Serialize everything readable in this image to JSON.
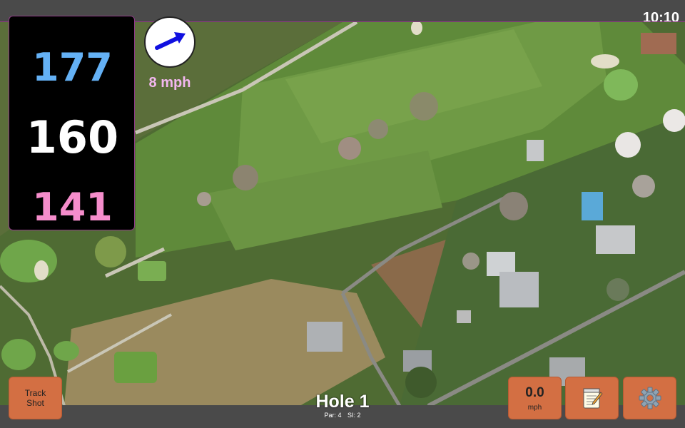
{
  "status": {
    "clock": "10:10"
  },
  "distances": {
    "back": "177",
    "middle": "160",
    "front": "141"
  },
  "wind": {
    "speed": "8 mph",
    "icon": "wind-arrow-icon"
  },
  "buttons": {
    "track_shot_line1": "Track",
    "track_shot_line2": "Shot",
    "shot_speed_value": "0.0",
    "shot_speed_unit": "mph",
    "notes_icon": "notepad-icon",
    "settings_icon": "gear-icon"
  },
  "hole": {
    "title": "Hole 1",
    "par": "Par: 4",
    "si": "SI: 2"
  },
  "colors": {
    "back": "#64b1f5",
    "middle": "#ffffff",
    "front": "#f58dcb",
    "button": "#d36f43",
    "wind": "#f2b7ef"
  }
}
